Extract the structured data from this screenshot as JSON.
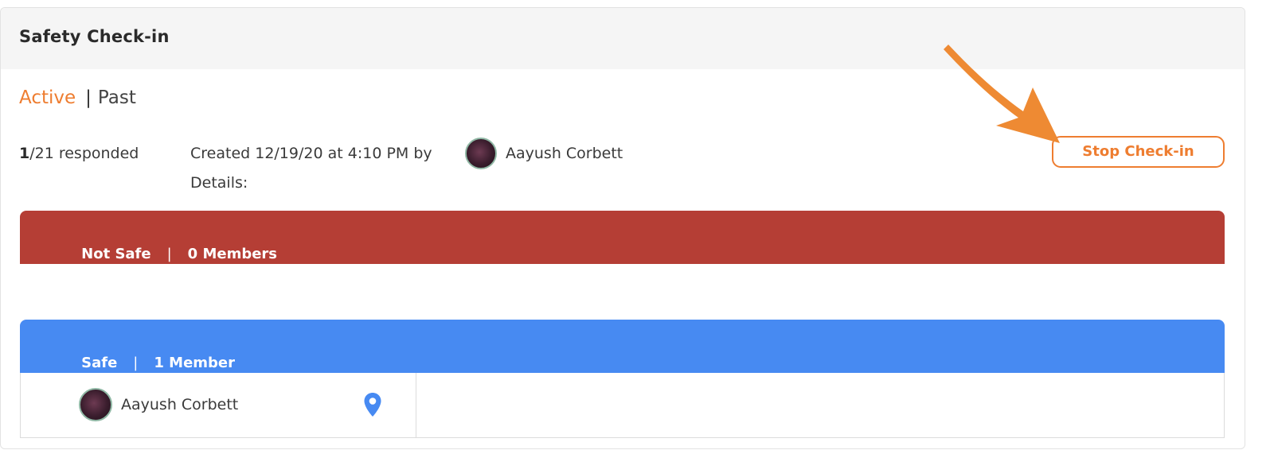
{
  "card": {
    "title": "Safety Check-in"
  },
  "tabs": {
    "active_label": "Active",
    "separator": "|",
    "past_label": "Past"
  },
  "summary": {
    "responded_count": "1",
    "responded_total_text": "/21 responded",
    "created_text": "Created 12/19/20 at 4:10 PM by",
    "creator_name": "Aayush Corbett",
    "details_label": "Details:"
  },
  "actions": {
    "stop_checkin_label": "Stop Check-in"
  },
  "groups": {
    "not_safe": {
      "label": "Not Safe",
      "separator": "|",
      "count_text": "0 Members"
    },
    "safe": {
      "label": "Safe",
      "separator": "|",
      "count_text": "1 Member",
      "members": [
        {
          "name": "Aayush Corbett",
          "icon": "location-pin-icon"
        }
      ]
    }
  },
  "colors": {
    "accent_orange": "#ee7d30",
    "not_safe_red": "#b53e35",
    "safe_blue": "#478af2",
    "annotation_arrow": "#ee8a33"
  }
}
